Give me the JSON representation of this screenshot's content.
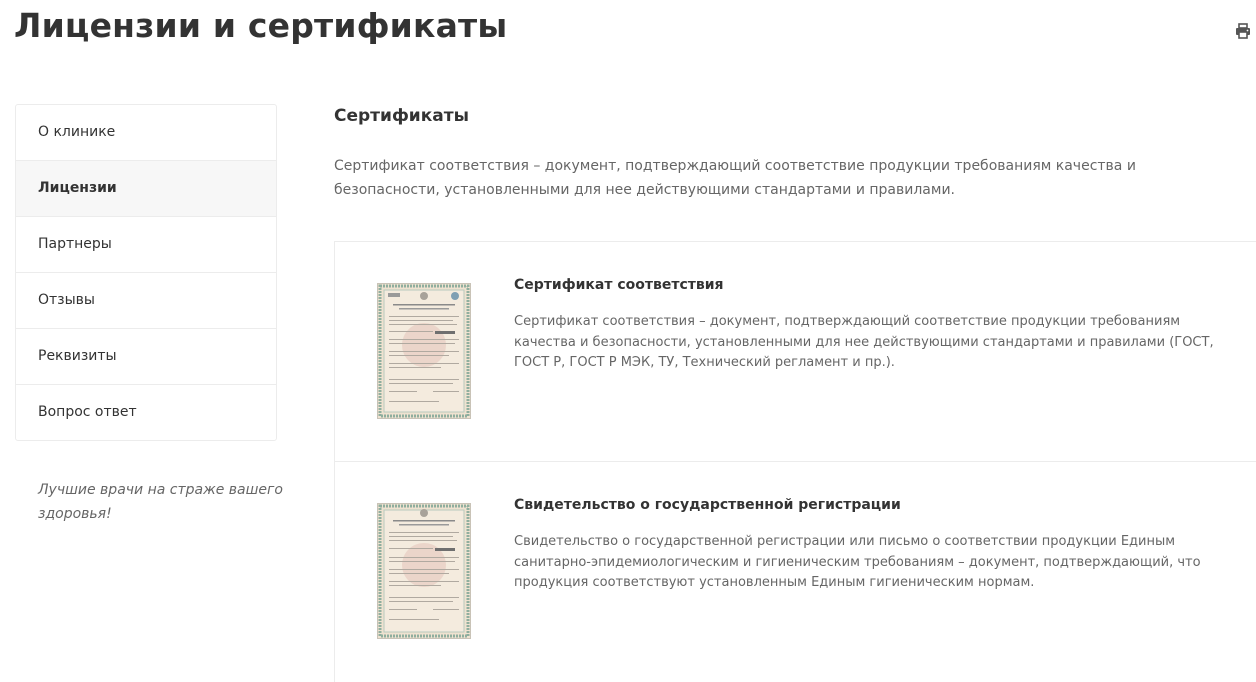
{
  "page": {
    "title": "Лицензии и сертификаты"
  },
  "toolbar": {
    "print_icon": "printer-icon"
  },
  "sidebar": {
    "items": [
      {
        "label": "О клинике",
        "active": false
      },
      {
        "label": "Лицензии",
        "active": true
      },
      {
        "label": "Партнеры",
        "active": false
      },
      {
        "label": "Отзывы",
        "active": false
      },
      {
        "label": "Реквизиты",
        "active": false
      },
      {
        "label": "Вопрос ответ",
        "active": false
      }
    ],
    "slogan": "Лучшие врачи на страже вашего здоровья!"
  },
  "section": {
    "title": "Сертификаты",
    "intro": "Сертификат соответствия – документ, подтверждающий соответствие продукции требованиям качества и безопасности, установленными для нее действующими стандартами и правилами."
  },
  "certificates": [
    {
      "title": "Сертификат соответствия",
      "description": "Сертификат соответствия – документ, подтверждающий соответствие продукции требованиям качества и безопасности, установленными для нее действующими стандартами и правилами (ГОСТ, ГОСТ Р, ГОСТ Р МЭК, ТУ, Технический регламент и пр.)."
    },
    {
      "title": "Свидетельство о государственной регистрации",
      "description": "Свидетельство о государственной регистрации или письмо о соответствии продукции Единым санитарно-эпидемиологическим и гигиеническим требованиям – документ, подтверждающий, что продукция соответствуют установленным Единым гигиеническим нормам."
    }
  ],
  "colors": {
    "text": "#333333",
    "muted": "#666666",
    "border": "#ececec",
    "active_bg": "#f7f7f7",
    "certificate_frame": "#8fae9e",
    "certificate_paper": "#efe2d0"
  }
}
